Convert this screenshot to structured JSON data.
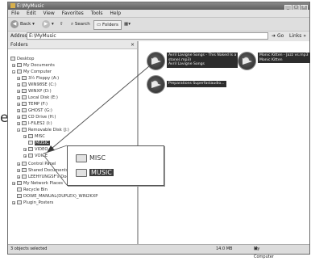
{
  "window": {
    "title": "E:\\MyMusic"
  },
  "menu": [
    "File",
    "Edit",
    "View",
    "Favorites",
    "Tools",
    "Help"
  ],
  "toolbar": {
    "back": "Back",
    "search": "Search",
    "folders": "Folders"
  },
  "address": {
    "label": "Address",
    "value": "E:\\MyMusic",
    "go": "Go",
    "links": "Links"
  },
  "folders_pane": {
    "title": "Folders",
    "close": "×"
  },
  "tree": [
    {
      "label": "Desktop"
    },
    {
      "label": "My Documents"
    },
    {
      "label": "My Computer"
    },
    {
      "label": "3½ Floppy (A:)"
    },
    {
      "label": "WIN98SE (C:)"
    },
    {
      "label": "WINXP (D:)"
    },
    {
      "label": "Local Disk (E:)"
    },
    {
      "label": "TEMP (F:)"
    },
    {
      "label": "GHOST (G:)"
    },
    {
      "label": "CD Drive (H:)"
    },
    {
      "label": "I-FILES2 (I:)"
    },
    {
      "label": "Removable Disk (J:)"
    },
    {
      "label": "MISC"
    },
    {
      "label": "MUSIC"
    },
    {
      "label": "VIDEO"
    },
    {
      "label": "VOICE"
    },
    {
      "label": "Control Panel"
    },
    {
      "label": "Shared Documents"
    },
    {
      "label": "LEEHYUNGSF's Documents"
    },
    {
      "label": "My Network Places"
    },
    {
      "label": "Recycle Bin"
    },
    {
      "label": "DOWE_MANUAL(DUPLEX)_WIN2KXP"
    },
    {
      "label": "Plugin_Posters"
    }
  ],
  "files": [
    {
      "line1": "Avril Lavigne Songs - This Naked Is a",
      "line2": "stone(.mp3)",
      "line3": "Avril Lavigne Songs"
    },
    {
      "line1": "Monic Kitten - Jazz vs.mp3",
      "line2": "Monic Kitten",
      "line3": ""
    },
    {
      "line1": "Preparations Superfastaudio...",
      "line2": "",
      "line3": ""
    }
  ],
  "popup": {
    "items": [
      {
        "label": "MISC"
      },
      {
        "label": "MUSIC"
      }
    ]
  },
  "outside_label": "e",
  "status": {
    "left": "3 objects selected",
    "size": "14.0 MB",
    "computer": "My Computer"
  }
}
